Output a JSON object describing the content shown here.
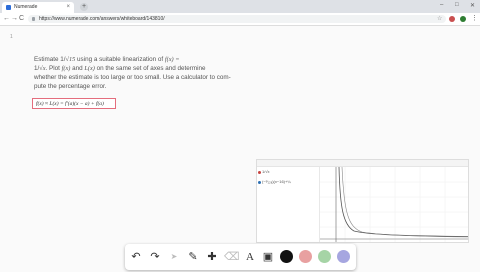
{
  "browser": {
    "tab_title": "Numerade",
    "tab_close": "×",
    "new_tab": "+",
    "url": "https://www.numerade.com/answers/whiteboard/143810/",
    "min": "–",
    "max": "□",
    "close": "✕",
    "back": "←",
    "forward": "→",
    "reload": "C",
    "star": "☆",
    "menu": "⋮",
    "ext_colors": [
      "#c94f4f",
      "#2e7d32"
    ]
  },
  "whiteboard": {
    "page_marker": "1",
    "problem": {
      "line1_pre": "Estimate 1/",
      "line1_root": "√15",
      "line1_mid": " using a suitable linearization of ",
      "line1_fx": "f(x) =",
      "line2_a": "1/",
      "line2_root": "√x",
      "line2_b": ". Plot ",
      "line2_fx": "f(x)",
      "line2_c": " and ",
      "line2_lx": "L(x)",
      "line2_d": " on the same set of axes and determine",
      "line3": "whether the estimate is too large or too small. Use a calculator to com-",
      "line4": "pute the percentage error."
    },
    "solution_formula": "f(x) ≈ L(x) = f′(a)(x − a) + f(a)"
  },
  "graph": {
    "expr1": "1/√x",
    "expr2": "(−¹⁄₁₂₈)(x−16)+¼",
    "color1": "#c74440",
    "color2": "#2d70b3",
    "curve_color": "#555555"
  },
  "tools": {
    "undo": "↶",
    "redo": "↷",
    "pointer": "➤",
    "pen": "✎",
    "add": "✚",
    "eraser": "⌫",
    "text": "A",
    "image": "▣",
    "colors": [
      "#111111",
      "#e8a0a0",
      "#a6d4a6",
      "#a6a6e0"
    ]
  }
}
